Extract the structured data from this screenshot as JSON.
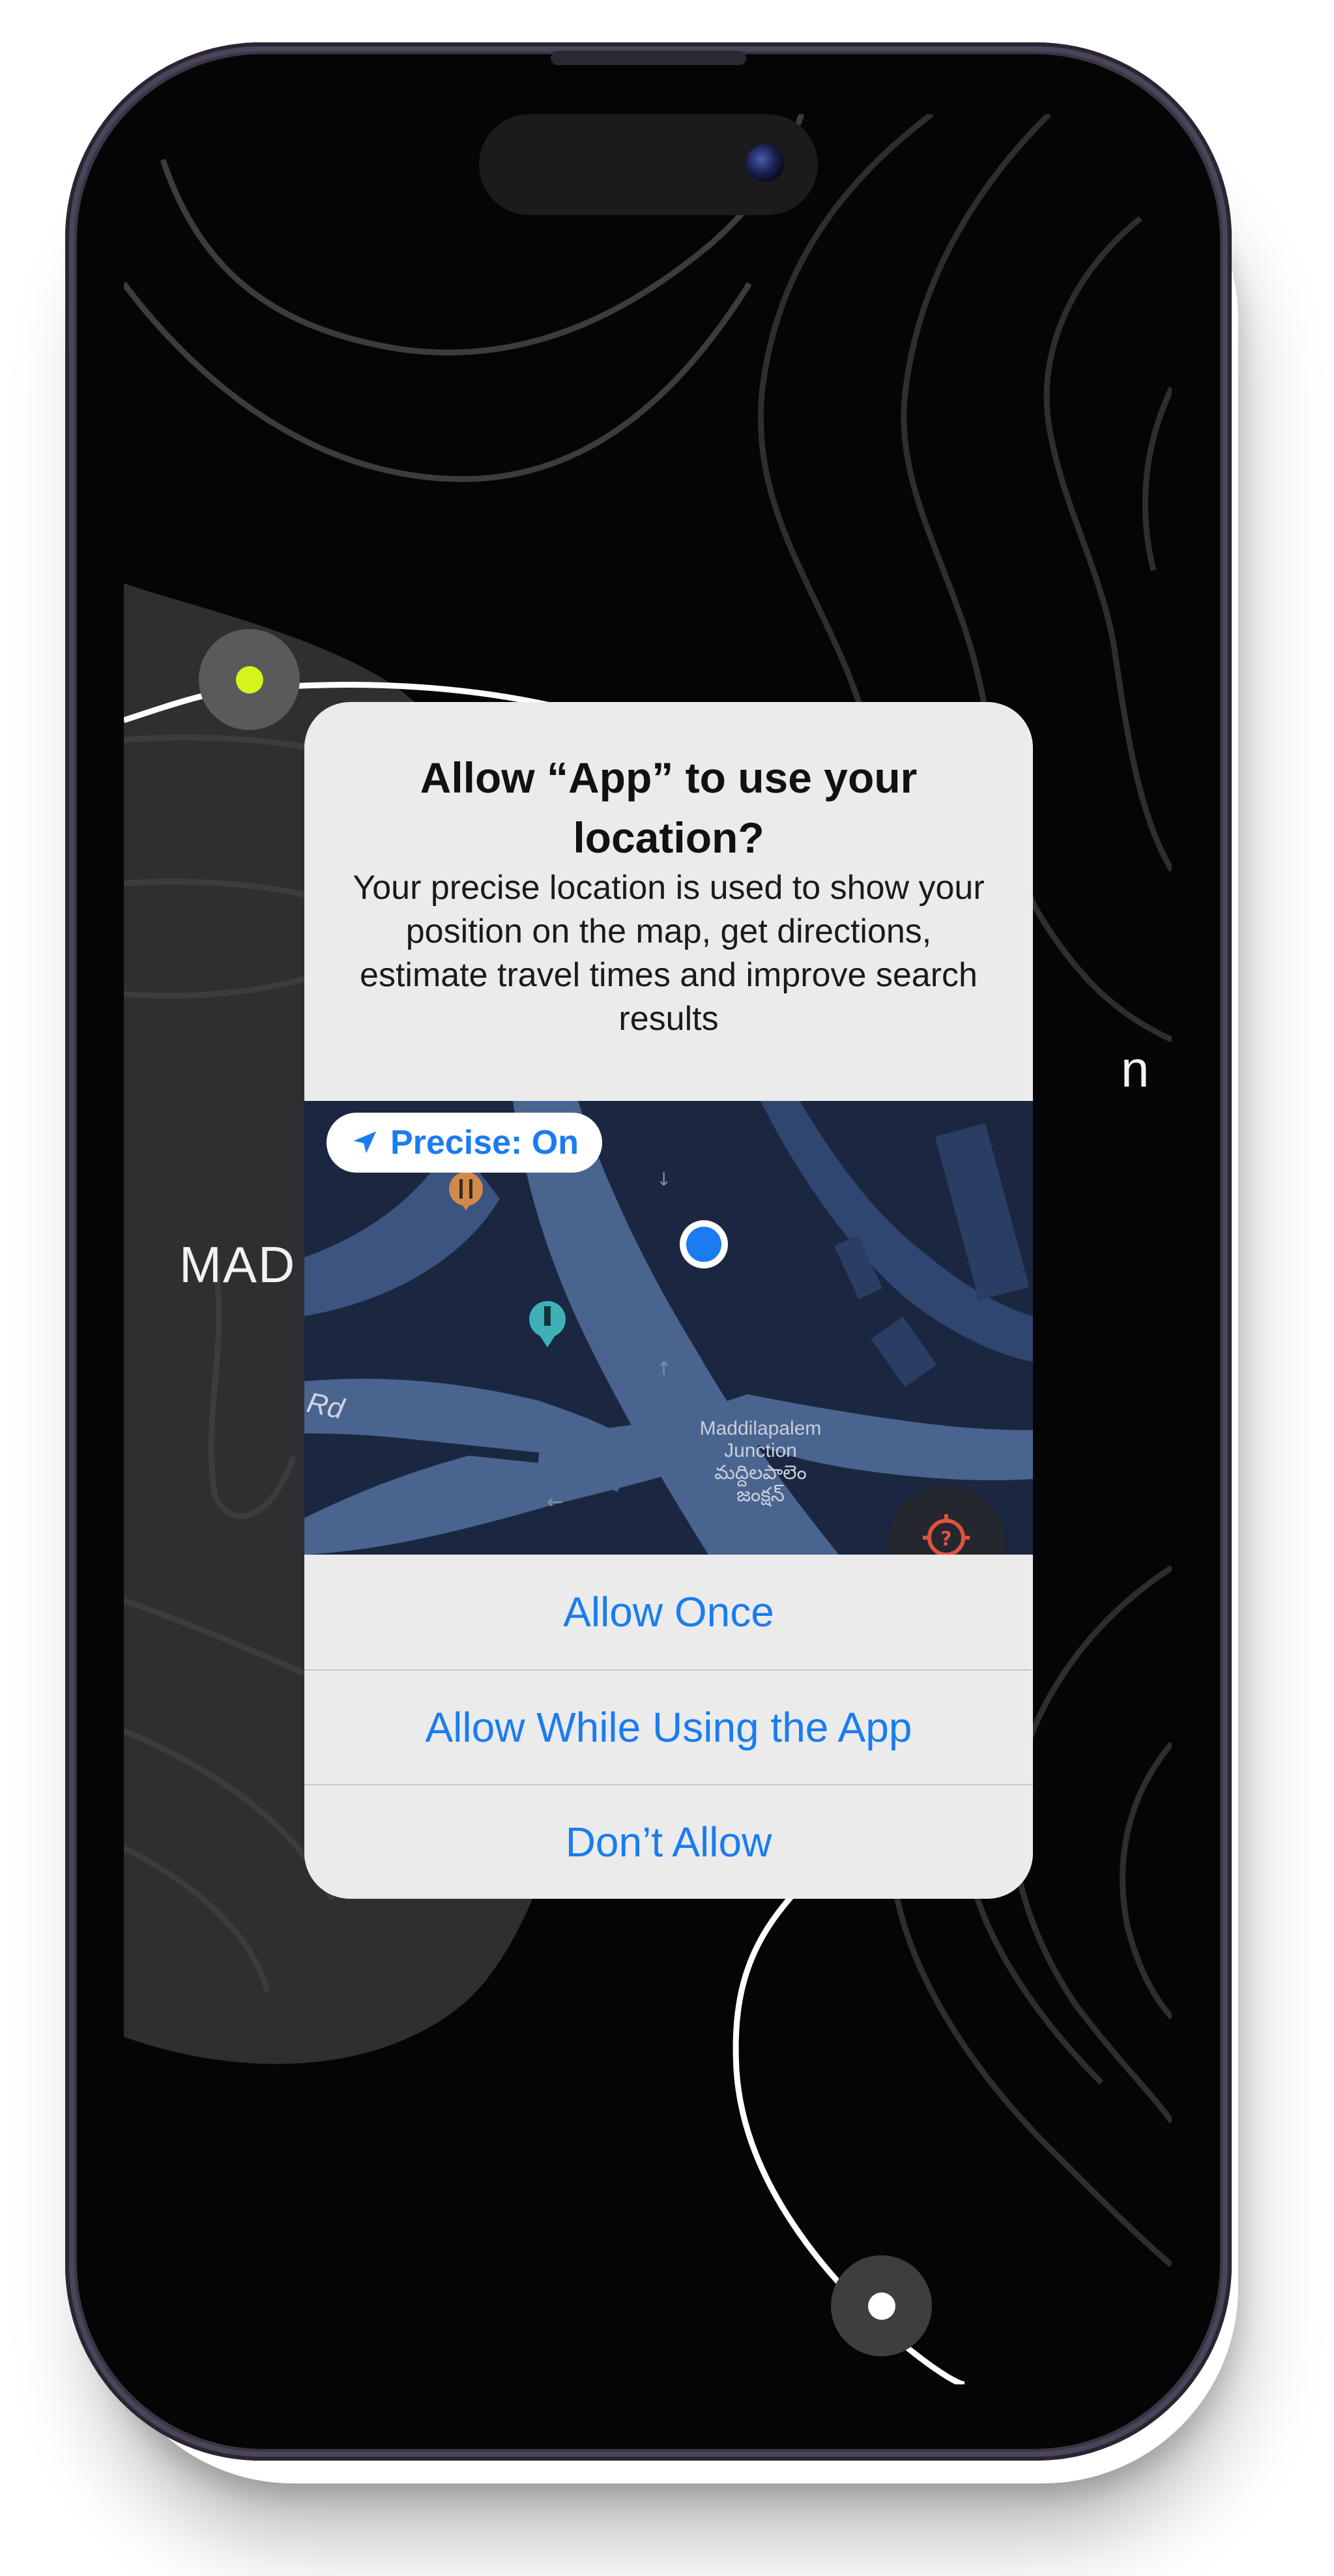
{
  "device": {
    "frame_color": "#3a3445",
    "accent_origin": "#d7f51a"
  },
  "background_map": {
    "labels": {
      "left_label": "MAD",
      "right_label": "n"
    }
  },
  "alert": {
    "title": "Allow “App” to use your location?",
    "message": "Your precise location is used to show your position on the map, get directions, estimate travel times and improve search results",
    "precise_toggle": {
      "icon": "location-arrow-icon",
      "label": "Precise: On"
    },
    "map_preview": {
      "junction_label_line1": "Maddilapalem",
      "junction_label_line2": "Junction",
      "junction_label_line3": "మద్దిలపాలెం",
      "junction_label_line4": "జంక్షన్",
      "road_label": "Rd",
      "user_dot_color": "#1a7cf0"
    },
    "buttons": [
      {
        "label": "Allow Once"
      },
      {
        "label": "Allow While Using the App"
      },
      {
        "label": "Don’t Allow"
      }
    ],
    "accent_color": "#1a7cf0"
  }
}
